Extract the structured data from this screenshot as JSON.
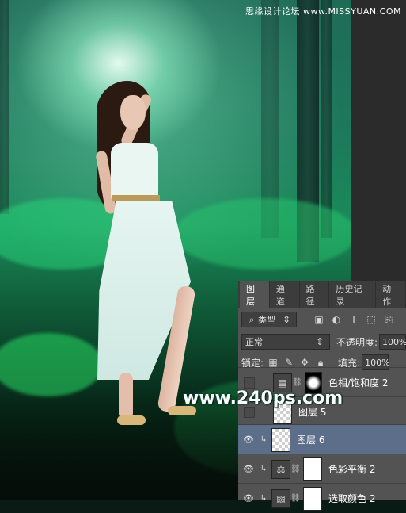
{
  "watermarks": {
    "top_right": "思缘设计论坛 www.MISSYUAN.COM",
    "site": "www.240ps.com"
  },
  "layers_panel": {
    "tabs": [
      "图层",
      "通道",
      "路径",
      "历史记录",
      "动作"
    ],
    "active_tab": "图层",
    "filter_kind": "类型",
    "blend_mode": "正常",
    "opacity_label": "不透明度:",
    "opacity_value": "100%",
    "lock_label": "锁定:",
    "fill_label": "填充:",
    "fill_value": "100%",
    "layers": [
      {
        "name": "色相/饱和度 2",
        "visible": false,
        "type": "adjustment-hue",
        "selected": false
      },
      {
        "name": "图层 5",
        "visible": false,
        "type": "pixel",
        "selected": false
      },
      {
        "name": "图层 6",
        "visible": true,
        "type": "pixel",
        "selected": true
      },
      {
        "name": "色彩平衡 2",
        "visible": true,
        "type": "adjustment-balance",
        "selected": false
      },
      {
        "name": "选取颜色 2",
        "visible": true,
        "type": "adjustment-selective",
        "selected": false
      }
    ]
  },
  "colors": {
    "panel_bg": "#535353",
    "selected_layer": "#5c6e8a",
    "tab_bar": "#3c3c3c"
  },
  "icons": {
    "search": "search-icon",
    "eye": "eye-icon",
    "lock": "lock-icon"
  }
}
